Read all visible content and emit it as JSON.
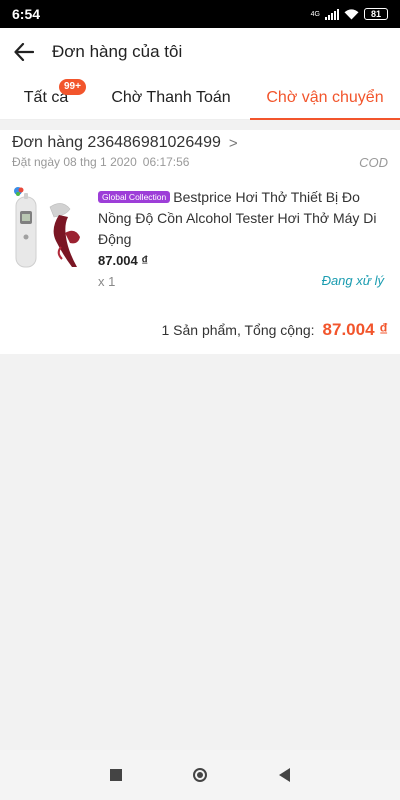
{
  "status_bar": {
    "time": "6:54",
    "network": "4G",
    "battery": "81",
    "icons": [
      "signal-icon",
      "wifi-icon",
      "battery-icon"
    ]
  },
  "header": {
    "title": "Đơn hàng của tôi",
    "back_icon": "arrow-left-icon"
  },
  "tabs": [
    {
      "label": "Tất cả",
      "badge": "99+",
      "active": false
    },
    {
      "label": "Chờ Thanh Toán",
      "active": false
    },
    {
      "label": "Chờ vận chuyển",
      "active": true
    }
  ],
  "order": {
    "id_label": "Đơn hàng 236486981026499",
    "chevron": ">",
    "date_text": "Đặt ngày 08 thg 1 2020",
    "time_text": "06:17:56",
    "payment_method": "COD",
    "item": {
      "tag": "Global Collection",
      "name": "Bestprice Hơi Thở Thiết Bị Đo Nồng Độ Cồn Alcohol Tester Hơi Thở Máy Di Động",
      "price": "87.004 ₫",
      "quantity": "x 1",
      "status": "Đang xử lý"
    },
    "total_label": "1 Sản phẩm, Tổng cộng:",
    "total_value": "87.004 ₫"
  },
  "nav": {
    "items": [
      "recents-square-icon",
      "home-circle-icon",
      "back-triangle-icon"
    ]
  },
  "colors": {
    "accent": "#f2552c",
    "tag": "#9d3ed8",
    "status": "#1a9cb0",
    "badge": "#f2552c"
  }
}
